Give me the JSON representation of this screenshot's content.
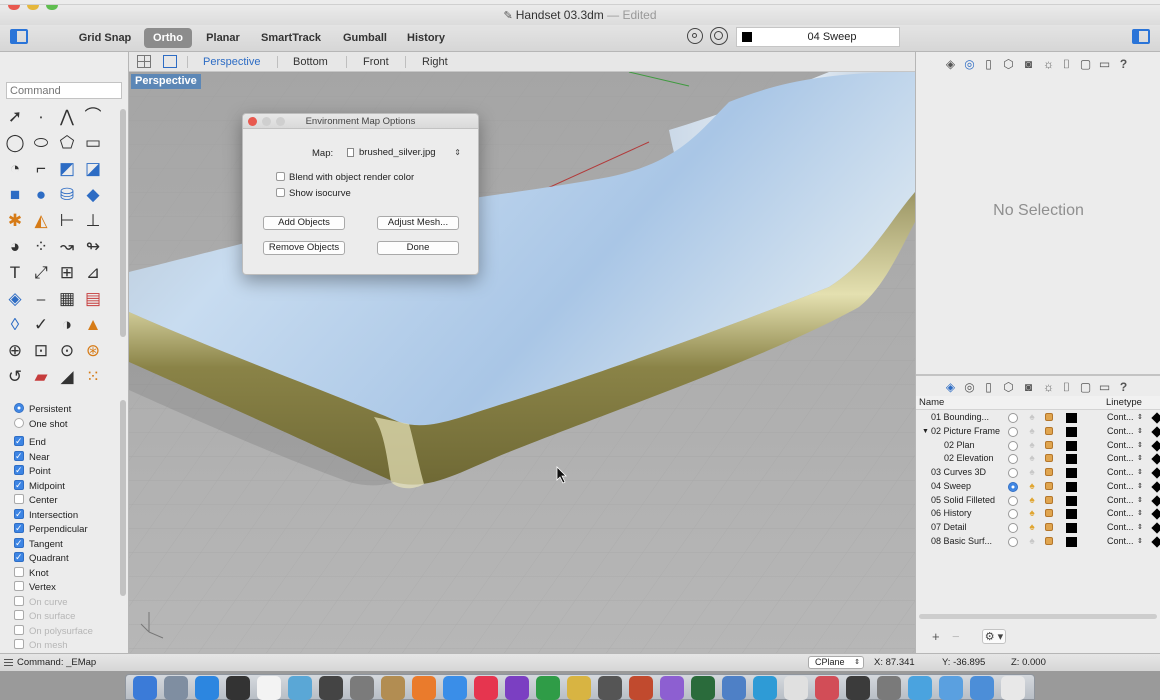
{
  "window": {
    "title": "Handset 03.3dm",
    "edited": "Edited"
  },
  "toolbar": {
    "grid_snap": "Grid Snap",
    "ortho": "Ortho",
    "planar": "Planar",
    "smarttrack": "SmartTrack",
    "gumball": "Gumball",
    "history": "History",
    "current_layer": "04 Sweep"
  },
  "command": {
    "placeholder": "Command"
  },
  "osnap": {
    "persistent": "Persistent",
    "one_shot": "One shot",
    "items": [
      {
        "label": "End",
        "checked": true,
        "enabled": true
      },
      {
        "label": "Near",
        "checked": true,
        "enabled": true
      },
      {
        "label": "Point",
        "checked": true,
        "enabled": true
      },
      {
        "label": "Midpoint",
        "checked": true,
        "enabled": true
      },
      {
        "label": "Center",
        "checked": false,
        "enabled": true
      },
      {
        "label": "Intersection",
        "checked": true,
        "enabled": true
      },
      {
        "label": "Perpendicular",
        "checked": true,
        "enabled": true
      },
      {
        "label": "Tangent",
        "checked": true,
        "enabled": true
      },
      {
        "label": "Quadrant",
        "checked": true,
        "enabled": true
      },
      {
        "label": "Knot",
        "checked": false,
        "enabled": true
      },
      {
        "label": "Vertex",
        "checked": false,
        "enabled": true
      },
      {
        "label": "On curve",
        "checked": false,
        "enabled": false
      },
      {
        "label": "On surface",
        "checked": false,
        "enabled": false
      },
      {
        "label": "On polysurface",
        "checked": false,
        "enabled": false
      },
      {
        "label": "On mesh",
        "checked": false,
        "enabled": false
      }
    ]
  },
  "viewtabs": {
    "perspective": "Perspective",
    "top": "Bottom",
    "front": "Front",
    "right": "Right"
  },
  "viewport": {
    "label": "Perspective"
  },
  "dialog": {
    "title": "Environment Map Options",
    "map_label": "Map:",
    "map_value": "brushed_silver.jpg",
    "blend": "Blend with object render color",
    "isocurve": "Show isocurve",
    "add_objects": "Add Objects",
    "adjust_mesh": "Adjust Mesh...",
    "remove_objects": "Remove Objects",
    "done": "Done"
  },
  "properties": {
    "empty": "No Selection"
  },
  "layers": {
    "col_name": "Name",
    "col_linetype": "Linetype",
    "rows": [
      {
        "name": "01 Bounding...",
        "indent": 0,
        "expanded": false,
        "current": false,
        "light_on": false,
        "linetype": "Cont..."
      },
      {
        "name": "02 Picture Frame",
        "indent": 0,
        "expanded": true,
        "current": false,
        "light_on": false,
        "linetype": "Cont..."
      },
      {
        "name": "02 Plan",
        "indent": 1,
        "expanded": false,
        "current": false,
        "light_on": false,
        "linetype": "Cont..."
      },
      {
        "name": "02 Elevation",
        "indent": 1,
        "expanded": false,
        "current": false,
        "light_on": false,
        "linetype": "Cont..."
      },
      {
        "name": "03 Curves 3D",
        "indent": 0,
        "expanded": false,
        "current": false,
        "light_on": false,
        "linetype": "Cont..."
      },
      {
        "name": "04 Sweep",
        "indent": 0,
        "expanded": false,
        "current": true,
        "light_on": true,
        "linetype": "Cont..."
      },
      {
        "name": "05 Solid Filleted",
        "indent": 0,
        "expanded": false,
        "current": false,
        "light_on": true,
        "linetype": "Cont..."
      },
      {
        "name": "06 History",
        "indent": 0,
        "expanded": false,
        "current": false,
        "light_on": true,
        "linetype": "Cont..."
      },
      {
        "name": "07 Detail",
        "indent": 0,
        "expanded": false,
        "current": false,
        "light_on": true,
        "linetype": "Cont..."
      },
      {
        "name": "08 Basic Surf...",
        "indent": 0,
        "expanded": false,
        "current": false,
        "light_on": false,
        "linetype": "Cont..."
      }
    ]
  },
  "status": {
    "command": "Command: _EMap",
    "cplane": "CPlane",
    "x": "X: 87.341",
    "y": "Y: -36.895",
    "z": "Z: 0.000"
  },
  "colors": {
    "accent": "#2d6cc4",
    "layer_color": "#000000",
    "viewport_bg": "#aeaeae",
    "perspective_label_bg": "#5c87b6"
  }
}
